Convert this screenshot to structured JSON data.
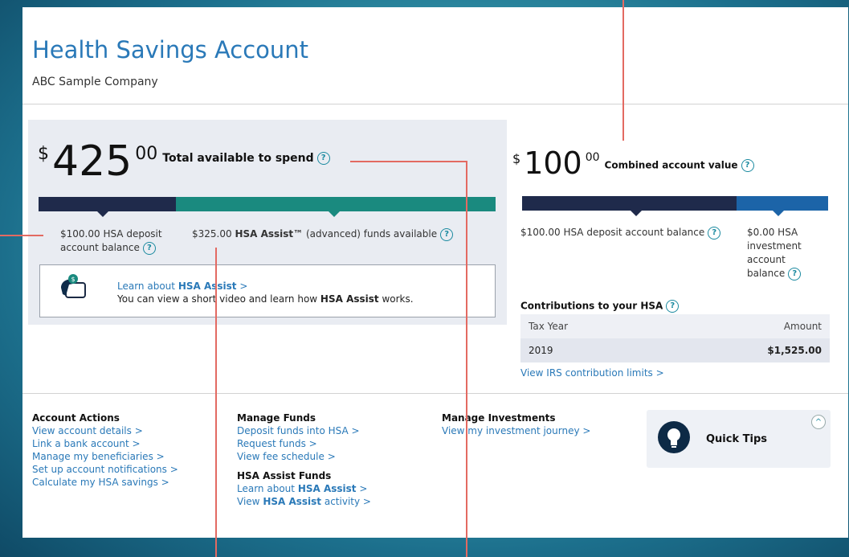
{
  "header": {
    "title": "Health Savings Account",
    "company": "ABC Sample Company"
  },
  "available": {
    "currency": "$",
    "integer": "425",
    "cents": "00",
    "label": "Total available to spend",
    "deposit_text": "$100.00 HSA deposit account balance",
    "assist_amount": "$325.00",
    "assist_brand": "HSA Assist™",
    "assist_rest": "(advanced) funds available",
    "learn_prefix": "Learn about",
    "learn_brand": "HSA Assist",
    "learn_suffix": ">",
    "learn_line2_prefix": "You can view a short video and learn how",
    "learn_line2_brand": "HSA Assist",
    "learn_line2_suffix": "works."
  },
  "combined": {
    "currency": "$",
    "integer": "100",
    "cents": "00",
    "label": "Combined account value",
    "deposit_balance": "$100.00 HSA deposit account balance",
    "investment_balance_line1": "$0.00 HSA",
    "investment_balance_line2": "investment",
    "investment_balance_line3": "account",
    "investment_balance_line4": "balance"
  },
  "contributions": {
    "title": "Contributions to your HSA",
    "columns": [
      "Tax Year",
      "Amount"
    ],
    "rows": [
      {
        "year": "2019",
        "amount": "$1,525.00"
      }
    ],
    "irs_link": "View IRS contribution limits >"
  },
  "actions": {
    "account": {
      "heading": "Account Actions",
      "links": [
        "View account details >",
        "Link a bank account >",
        "Manage my beneficiaries >",
        "Set up account notifications >",
        "Calculate my HSA savings >"
      ]
    },
    "funds": {
      "heading": "Manage Funds",
      "links": [
        "Deposit funds into HSA >",
        "Request funds >",
        "View fee schedule >"
      ]
    },
    "assist": {
      "heading": "HSA Assist Funds",
      "learn_prefix": "Learn about",
      "learn_brand": "HSA Assist",
      "learn_suffix": ">",
      "view_prefix": "View",
      "view_brand": "HSA Assist",
      "view_suffix": "activity >"
    },
    "investments": {
      "heading": "Manage Investments",
      "links": [
        "View my investment journey >"
      ]
    }
  },
  "quick_tips": {
    "label": "Quick Tips",
    "chevron": "^"
  },
  "icons": {
    "help": "?",
    "chevron_up": "^"
  },
  "colors": {
    "navy": "#1f2a4b",
    "teal": "#1a8a7f",
    "blue": "#1c64a8",
    "link": "#2a79b8",
    "callout": "#e36a62"
  }
}
